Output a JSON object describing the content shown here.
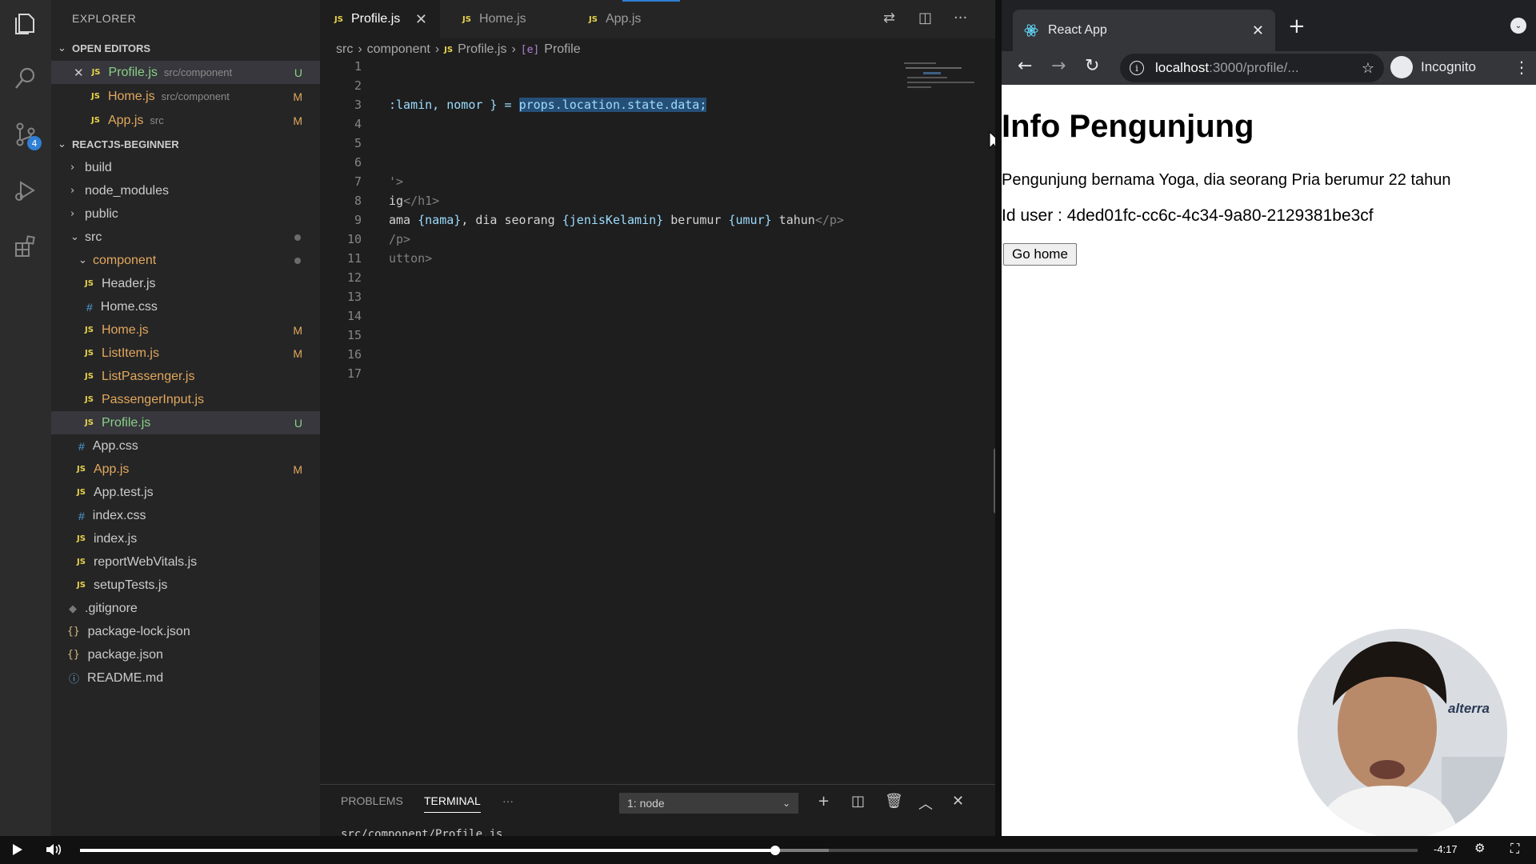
{
  "explorer": {
    "title": "EXPLORER",
    "open_editors_label": "OPEN EDITORS",
    "open_editors": [
      {
        "name": "Profile.js",
        "path": "src/component",
        "status": "U"
      },
      {
        "name": "Home.js",
        "path": "src/component",
        "status": "M"
      },
      {
        "name": "App.js",
        "path": "src",
        "status": "M"
      }
    ],
    "project_label": "REACTJS-BEGINNER",
    "tree": [
      {
        "name": "build"
      },
      {
        "name": "node_modules"
      },
      {
        "name": "public"
      },
      {
        "name": "src"
      },
      {
        "name": "component"
      },
      {
        "name": "Header.js"
      },
      {
        "name": "Home.css"
      },
      {
        "name": "Home.js",
        "status": "M"
      },
      {
        "name": "ListItem.js",
        "status": "M"
      },
      {
        "name": "ListPassenger.js"
      },
      {
        "name": "PassengerInput.js"
      },
      {
        "name": "Profile.js",
        "status": "U"
      },
      {
        "name": "App.css"
      },
      {
        "name": "App.js",
        "status": "M"
      },
      {
        "name": "App.test.js"
      },
      {
        "name": "index.css"
      },
      {
        "name": "index.js"
      },
      {
        "name": "reportWebVitals.js"
      },
      {
        "name": "setupTests.js"
      },
      {
        "name": ".gitignore"
      },
      {
        "name": "package-lock.json"
      },
      {
        "name": "package.json"
      },
      {
        "name": "README.md"
      }
    ],
    "scm_badge": "4"
  },
  "editor": {
    "tabs": [
      {
        "label": "Profile.js"
      },
      {
        "label": "Home.js"
      },
      {
        "label": "App.js"
      }
    ],
    "breadcrumb": [
      "src",
      "component",
      "Profile.js",
      "Profile"
    ],
    "line_numbers": [
      "1",
      "2",
      "3",
      "4",
      "5",
      "6",
      "7",
      "8",
      "9",
      "10",
      "11",
      "12",
      "13",
      "14",
      "15",
      "16",
      "17"
    ],
    "code": {
      "line3_a": ":lamin, nomor } = ",
      "line3_b": "props.location.state.data;",
      "line7": "'>",
      "line8_a": "ig",
      "line8_b": "</h1>",
      "line9_a": "ama ",
      "line9_b": "{nama}",
      "line9_c": ", dia seorang ",
      "line9_d": "{jenisKelamin}",
      "line9_e": " berumur ",
      "line9_f": "{umur}",
      "line9_g": " tahun",
      "line9_h": "</p>",
      "line10": "/p>",
      "line11": "utton>"
    }
  },
  "panel": {
    "tabs": [
      "PROBLEMS",
      "TERMINAL"
    ],
    "more": "···",
    "terminal_select": "1: node",
    "terminal_text": "src/component/Profile.js"
  },
  "browser": {
    "tab_title": "React App",
    "url_host": "localhost",
    "url_path": ":3000/profile/...",
    "profile_label": "Incognito",
    "page": {
      "heading": "Info Pengunjung",
      "line1": "Pengunjung bernama Yoga, dia seorang Pria berumur 22 tahun",
      "line2": "Id user : 4ded01fc-cc6c-4c34-9a80-2129381be3cf",
      "button": "Go home"
    }
  },
  "webcam": {
    "logo": "alterra"
  },
  "video": {
    "time": "-4:17",
    "progress": 0.52,
    "buffered": 0.56
  }
}
